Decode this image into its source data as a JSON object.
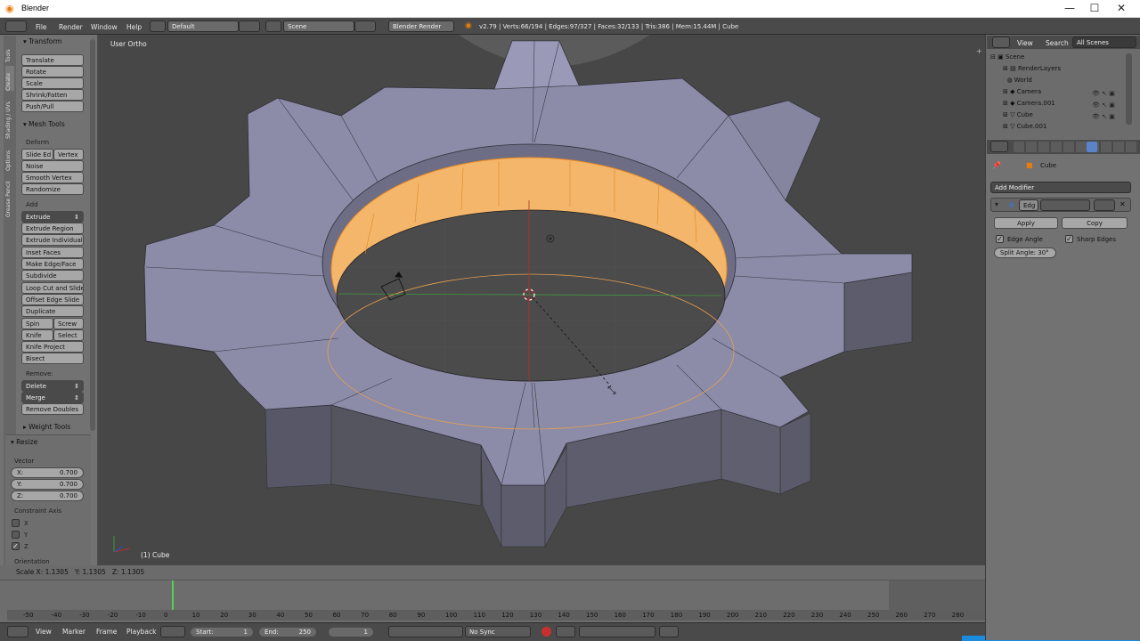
{
  "window": {
    "title": "Blender",
    "controls": [
      "—",
      "☐",
      "✕"
    ]
  },
  "infobar": {
    "menus": [
      "File",
      "Render",
      "Window",
      "Help"
    ],
    "screen_layout": "Default",
    "scene": "Scene",
    "render_engine": "Blender Render",
    "stats": "v2.79 | Verts:66/194 | Edges:97/327 | Faces:32/133 | Tris:386 | Mem:15.44M | Cube"
  },
  "toolshelf": {
    "tabs": [
      "Tools",
      "Create",
      "Shading / UVs",
      "Options",
      "Grease Pencil"
    ],
    "transform": {
      "header": "Transform",
      "buttons": [
        "Translate",
        "Rotate",
        "Scale",
        "Shrink/Fatten",
        "Push/Pull"
      ]
    },
    "mesh_tools": {
      "header": "Mesh Tools",
      "deform_label": "Deform",
      "deform_pair": [
        "Slide Ed",
        "Vertex"
      ],
      "deform_buttons": [
        "Noise",
        "Smooth Vertex",
        "Randomize"
      ],
      "add_label": "Add",
      "extrude": "Extrude",
      "add_buttons": [
        "Extrude Region",
        "Extrude Individual",
        "Inset Faces",
        "Make Edge/Face",
        "Subdivide",
        "Loop Cut and Slide",
        "Offset Edge Slide",
        "Duplicate"
      ],
      "pairs": [
        [
          "Spin",
          "Screw"
        ],
        [
          "Knife",
          "Select"
        ]
      ],
      "more_buttons": [
        "Knife Project",
        "Bisect"
      ],
      "remove_label": "Remove:",
      "delete": "Delete",
      "merge": "Merge",
      "remove_doubles": "Remove Doubles"
    },
    "weight_tools": "Weight Tools",
    "operator": {
      "header": "Resize",
      "vector_label": "Vector",
      "vector": [
        {
          "axis": "X:",
          "value": "0.700"
        },
        {
          "axis": "Y:",
          "value": "0.700"
        },
        {
          "axis": "Z:",
          "value": "0.700"
        }
      ],
      "constraint_label": "Constraint Axis",
      "constraint": [
        {
          "axis": "X",
          "checked": false
        },
        {
          "axis": "Y",
          "checked": false
        },
        {
          "axis": "Z",
          "checked": true
        }
      ],
      "orientation_label": "Orientation"
    }
  },
  "viewport": {
    "view_label": "User Ortho",
    "object_label": "(1) Cube"
  },
  "status": {
    "scale_readout": "Scale X: 1.1305   Y: 1.1305   Z: 1.1305"
  },
  "timeline": {
    "ticks": [
      "-50",
      "-40",
      "-30",
      "-20",
      "-10",
      "0",
      "10",
      "20",
      "30",
      "40",
      "50",
      "60",
      "70",
      "80",
      "90",
      "100",
      "110",
      "120",
      "130",
      "140",
      "150",
      "160",
      "170",
      "180",
      "190",
      "200",
      "210",
      "220",
      "230",
      "240",
      "250",
      "260",
      "270",
      "280"
    ],
    "menus": [
      "View",
      "Marker",
      "Frame",
      "Playback"
    ],
    "start_label": "Start:",
    "start": "1",
    "end_label": "End:",
    "end": "250",
    "current": "1",
    "sync": "No Sync"
  },
  "outliner": {
    "menus": [
      "View",
      "Search"
    ],
    "filter": "All Scenes",
    "items": [
      "Scene",
      "RenderLayers",
      "World",
      "Camera",
      "Camera.001",
      "Cube",
      "Cube.001"
    ]
  },
  "properties": {
    "object": "Cube",
    "add_modifier": "Add Modifier",
    "modifier_name": "Edg",
    "apply": "Apply",
    "copy": "Copy",
    "edge_angle": "Edge Angle",
    "sharp_edges": "Sharp Edges",
    "split_angle": "Split Angle: 30°"
  },
  "colors": {
    "selection": "#f0a030",
    "face": "#8d8da8",
    "viewport_bg": "#474747"
  }
}
